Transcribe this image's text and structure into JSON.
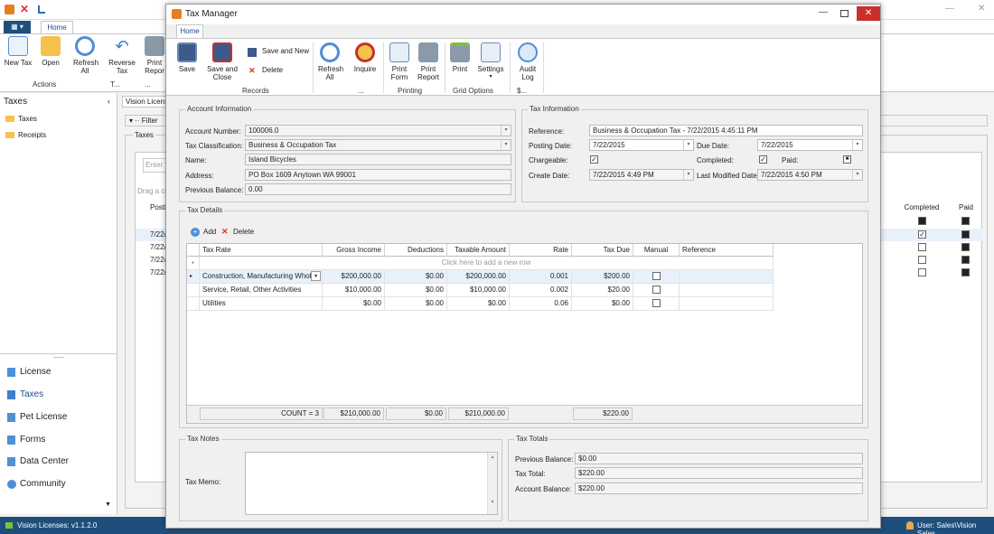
{
  "app": {
    "tab_home": "Home",
    "ribbon": [
      "New Tax",
      "Open",
      "Refresh All",
      "Reverse Tax",
      "Print Repor"
    ],
    "groups": [
      "Actions",
      "T...",
      "..."
    ],
    "nav_header": "Taxes",
    "nav_tree": [
      "Taxes",
      "Receipts"
    ],
    "nav_bottom": [
      "License",
      "Taxes",
      "Pet License",
      "Forms",
      "Data Center",
      "Community"
    ],
    "doc_tab": "Vision License:",
    "filter": "Filter",
    "taxes_group": "Taxes",
    "enter_text": "Enter t",
    "drag_text": "Drag a co",
    "posting_col": "Postin",
    "rows": [
      "7/22/",
      "7/22/",
      "7/22/",
      "7/22/"
    ],
    "completed_col": "Completed",
    "paid_col": "Paid",
    "status_left": "Vision Licenses: v1.1.2.0",
    "status_right": "User: Sales\\Vision Sales"
  },
  "dialog": {
    "title": "Tax Manager",
    "tab": "Home",
    "buttons": {
      "save": "Save",
      "save_close": "Save and Close",
      "save_new": "Save and New",
      "delete": "Delete",
      "refresh_all": "Refresh All",
      "inquire": "Inquire",
      "print_form": "Print Form",
      "print_report": "Print Report",
      "print": "Print",
      "settings": "Settings",
      "audit_log": "Audit Log"
    },
    "groups": {
      "records": "Records",
      "dots1": "...",
      "printing": "Printing",
      "grid_options": "Grid Options",
      "s": "$..."
    },
    "account": {
      "title": "Account Information",
      "account_number_label": "Account Number:",
      "account_number": "100006.0",
      "classification_label": "Tax Classification:",
      "classification": "Business & Occupation Tax",
      "name_label": "Name:",
      "name": "Island Bicycles",
      "address_label": "Address:",
      "address": "PO Box 1609 Anytown WA 99001",
      "prev_balance_label": "Previous Balance:",
      "prev_balance": "0.00"
    },
    "tax_info": {
      "title": "Tax Information",
      "reference_label": "Reference:",
      "reference": "Business & Occupation Tax - 7/22/2015 4:45:11 PM",
      "posting_date_label": "Posting Date:",
      "posting_date": "7/22/2015",
      "due_date_label": "Due Date:",
      "due_date": "7/22/2015",
      "chargeable_label": "Chargeable:",
      "completed_label": "Completed:",
      "paid_label": "Paid:",
      "create_date_label": "Create Date:",
      "create_date": "7/22/2015 4:49 PM",
      "last_modified_label": "Last Modified Date:",
      "last_modified": "7/22/2015 4:50 PM"
    },
    "tax_details": {
      "title": "Tax Details",
      "add": "Add",
      "delete": "Delete",
      "columns": [
        "Tax Rate",
        "Gross Income",
        "Deductions",
        "Taxable Amount",
        "Rate",
        "Tax Due",
        "Manual",
        "Reference"
      ],
      "new_row": "Click here to add a new row",
      "rows": [
        [
          "Construction, Manufacturing Whol...",
          "$200,000.00",
          "$0.00",
          "$200,000.00",
          "0.001",
          "$200.00"
        ],
        [
          "Service, Retail, Other Activities",
          "$10,000.00",
          "$0.00",
          "$10,000.00",
          "0.002",
          "$20.00"
        ],
        [
          "Utilities",
          "$0.00",
          "$0.00",
          "$0.00",
          "0.06",
          "$0.00"
        ]
      ],
      "footer": {
        "count": "COUNT = 3",
        "gross": "$210,000.00",
        "deductions": "$0.00",
        "taxable": "$210,000.00",
        "tax_due": "$220.00"
      }
    },
    "notes": {
      "title": "Tax Notes",
      "memo_label": "Tax Memo:"
    },
    "totals": {
      "title": "Tax Totals",
      "prev_label": "Previous Balance:",
      "prev": "$0.00",
      "total_label": "Tax Total:",
      "total": "$220.00",
      "account_label": "Account Balance:",
      "account": "$220.00"
    }
  }
}
